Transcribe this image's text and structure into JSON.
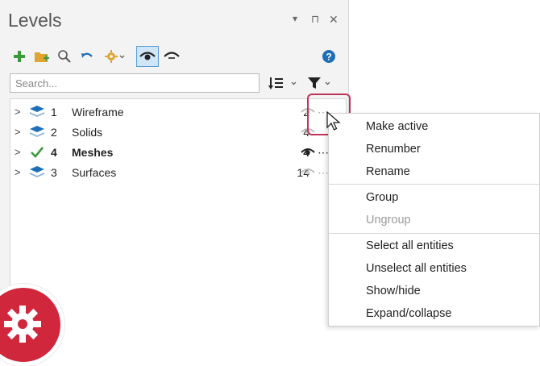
{
  "panel": {
    "title": "Levels",
    "header_buttons": [
      "▾",
      "⊓",
      "✕"
    ]
  },
  "toolbar": {
    "icons": [
      "add-level-icon",
      "add-folder-icon",
      "search-icon",
      "undo-icon",
      "settings-icon",
      "show-icon",
      "hide-icon",
      "help-icon"
    ]
  },
  "search": {
    "placeholder": "Search..."
  },
  "levels": [
    {
      "number": "1",
      "name": "Wireframe",
      "count": "2",
      "active": false
    },
    {
      "number": "2",
      "name": "Solids",
      "count": "4",
      "active": false
    },
    {
      "number": "4",
      "name": "Meshes",
      "count": "4",
      "active": true
    },
    {
      "number": "3",
      "name": "Surfaces",
      "count": "14",
      "active": false
    }
  ],
  "context_menu": {
    "items": [
      {
        "label": "Make active",
        "enabled": true
      },
      {
        "label": "Renumber",
        "enabled": true
      },
      {
        "label": "Rename",
        "enabled": true
      },
      {
        "label": "Group",
        "enabled": true
      },
      {
        "label": "Ungroup",
        "enabled": false
      },
      {
        "label": "Select all entities",
        "enabled": true
      },
      {
        "label": "Unselect all entities",
        "enabled": true
      },
      {
        "label": "Show/hide",
        "enabled": true
      },
      {
        "label": "Expand/collapse",
        "enabled": true
      }
    ]
  },
  "colors": {
    "accent_green": "#3a9a3a",
    "accent_blue": "#1e6fb8",
    "highlight": "#c0345a",
    "badge": "#d0273c"
  }
}
